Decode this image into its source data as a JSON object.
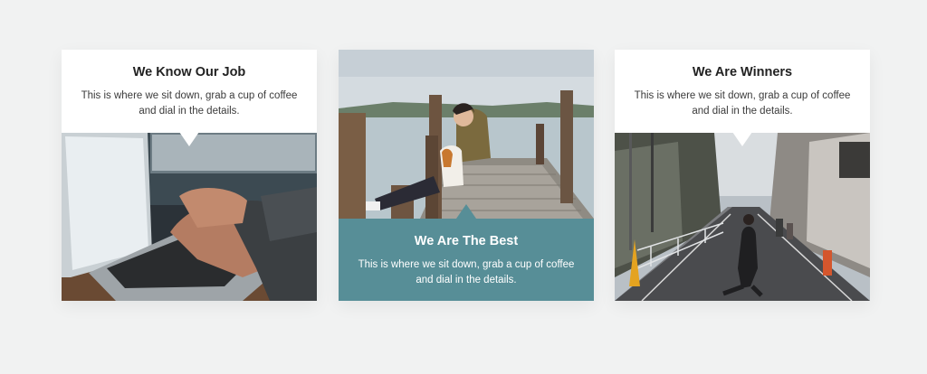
{
  "cards": [
    {
      "title": "We Know Our Job",
      "description": "This is where we sit down, grab a cup of coffee and dial in the details.",
      "photo": "laptop-typing-photo"
    },
    {
      "title": "We Are The Best",
      "description": "This is where we sit down, grab a cup of coffee and dial in the details.",
      "photo": "pier-with-dog-photo"
    },
    {
      "title": "We Are Winners",
      "description": "This is where we sit down, grab a cup of coffee and dial in the details.",
      "photo": "city-street-photo"
    }
  ],
  "colors": {
    "background": "#f1f2f2",
    "accent_teal": "#578e97",
    "card_white": "#ffffff"
  }
}
